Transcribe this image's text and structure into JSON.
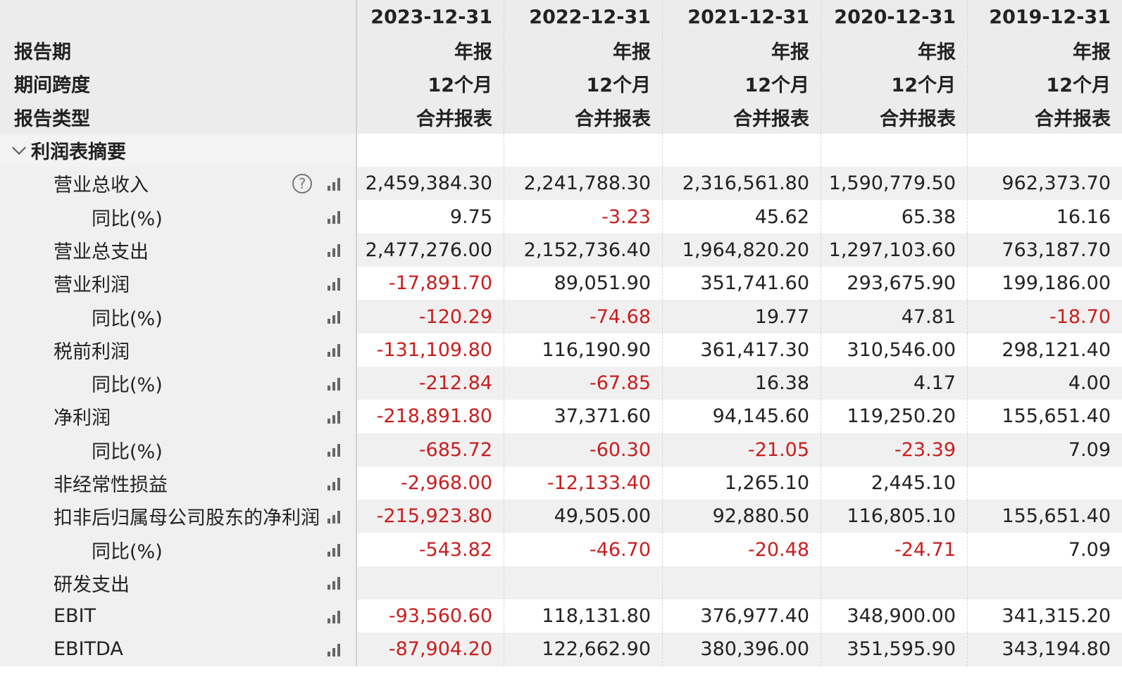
{
  "header": {
    "dates": [
      "2023-12-31",
      "2022-12-31",
      "2021-12-31",
      "2020-12-31",
      "2019-12-31"
    ],
    "report_period_label": "报告期",
    "report_period_values": [
      "年报",
      "年报",
      "年报",
      "年报",
      "年报"
    ],
    "span_label": "期间跨度",
    "span_values": [
      "12个月",
      "12个月",
      "12个月",
      "12个月",
      "12个月"
    ],
    "type_label": "报告类型",
    "type_values": [
      "合并报表",
      "合并报表",
      "合并报表",
      "合并报表",
      "合并报表"
    ]
  },
  "section": {
    "title": "利润表摘要"
  },
  "rows": [
    {
      "label": "营业总收入",
      "values": [
        "2,459,384.30",
        "2,241,788.30",
        "2,316,561.80",
        "1,590,779.50",
        "962,373.70"
      ]
    },
    {
      "label": "同比(%)",
      "values": [
        "9.75",
        "-3.23",
        "45.62",
        "65.38",
        "16.16"
      ]
    },
    {
      "label": "营业总支出",
      "values": [
        "2,477,276.00",
        "2,152,736.40",
        "1,964,820.20",
        "1,297,103.60",
        "763,187.70"
      ]
    },
    {
      "label": "营业利润",
      "values": [
        "-17,891.70",
        "89,051.90",
        "351,741.60",
        "293,675.90",
        "199,186.00"
      ]
    },
    {
      "label": "同比(%)",
      "values": [
        "-120.29",
        "-74.68",
        "19.77",
        "47.81",
        "-18.70"
      ]
    },
    {
      "label": "税前利润",
      "values": [
        "-131,109.80",
        "116,190.90",
        "361,417.30",
        "310,546.00",
        "298,121.40"
      ]
    },
    {
      "label": "同比(%)",
      "values": [
        "-212.84",
        "-67.85",
        "16.38",
        "4.17",
        "4.00"
      ]
    },
    {
      "label": "净利润",
      "values": [
        "-218,891.80",
        "37,371.60",
        "94,145.60",
        "119,250.20",
        "155,651.40"
      ]
    },
    {
      "label": "同比(%)",
      "values": [
        "-685.72",
        "-60.30",
        "-21.05",
        "-23.39",
        "7.09"
      ]
    },
    {
      "label": "非经常性损益",
      "values": [
        "-2,968.00",
        "-12,133.40",
        "1,265.10",
        "2,445.10",
        ""
      ]
    },
    {
      "label": "扣非后归属母公司股东的净利润",
      "values": [
        "-215,923.80",
        "49,505.00",
        "92,880.50",
        "116,805.10",
        "155,651.40"
      ]
    },
    {
      "label": "同比(%)",
      "values": [
        "-543.82",
        "-46.70",
        "-20.48",
        "-24.71",
        "7.09"
      ]
    },
    {
      "label": "研发支出",
      "values": [
        "",
        "",
        "",
        "",
        ""
      ]
    },
    {
      "label": "EBIT",
      "values": [
        "-93,560.60",
        "118,131.80",
        "376,977.40",
        "348,900.00",
        "341,315.20"
      ]
    },
    {
      "label": "EBITDA",
      "values": [
        "-87,904.20",
        "122,662.90",
        "380,396.00",
        "351,595.90",
        "343,194.80"
      ]
    }
  ],
  "icons": {
    "chart": "bar-chart-icon",
    "help": "help-icon",
    "collapse": "chevron-down-icon"
  },
  "help_glyph": "?",
  "colors": {
    "negative": "#c81e1e",
    "header_bg": "#ececec",
    "zebra_bg": "#f0f0f0"
  }
}
